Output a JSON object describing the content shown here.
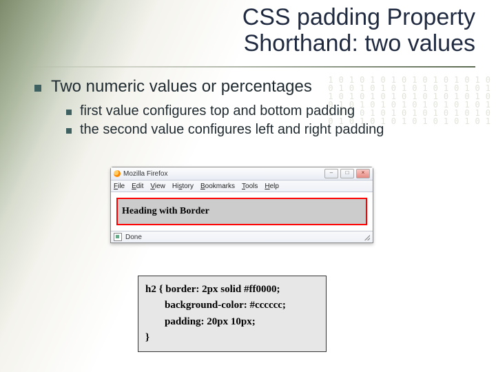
{
  "title_line1": "CSS padding Property",
  "title_line2": "Shorthand: two values",
  "bullets": {
    "main": "Two numeric values or percentages",
    "sub1": "first value configures top and bottom padding",
    "sub2": "the second value configures left and right padding"
  },
  "firefox": {
    "app_title": "Mozilla Firefox",
    "menu": {
      "file": "File",
      "edit": "Edit",
      "view": "View",
      "history": "History",
      "bookmarks": "Bookmarks",
      "tools": "Tools",
      "help": "Help"
    },
    "heading_text": "Heading with Border",
    "status": "Done",
    "win_min": "–",
    "win_max": "□",
    "win_close": "×"
  },
  "code": {
    "l1": "h2 { border: 2px solid #ff0000;",
    "l2": "background-color: #cccccc;",
    "l3": "padding: 20px 10px;",
    "l4": "}"
  },
  "deco_binary": "1010101010101010\n0101010101010101\n1010101010101010\n0101010101010101\n1010101010101010\n0101010101010101"
}
